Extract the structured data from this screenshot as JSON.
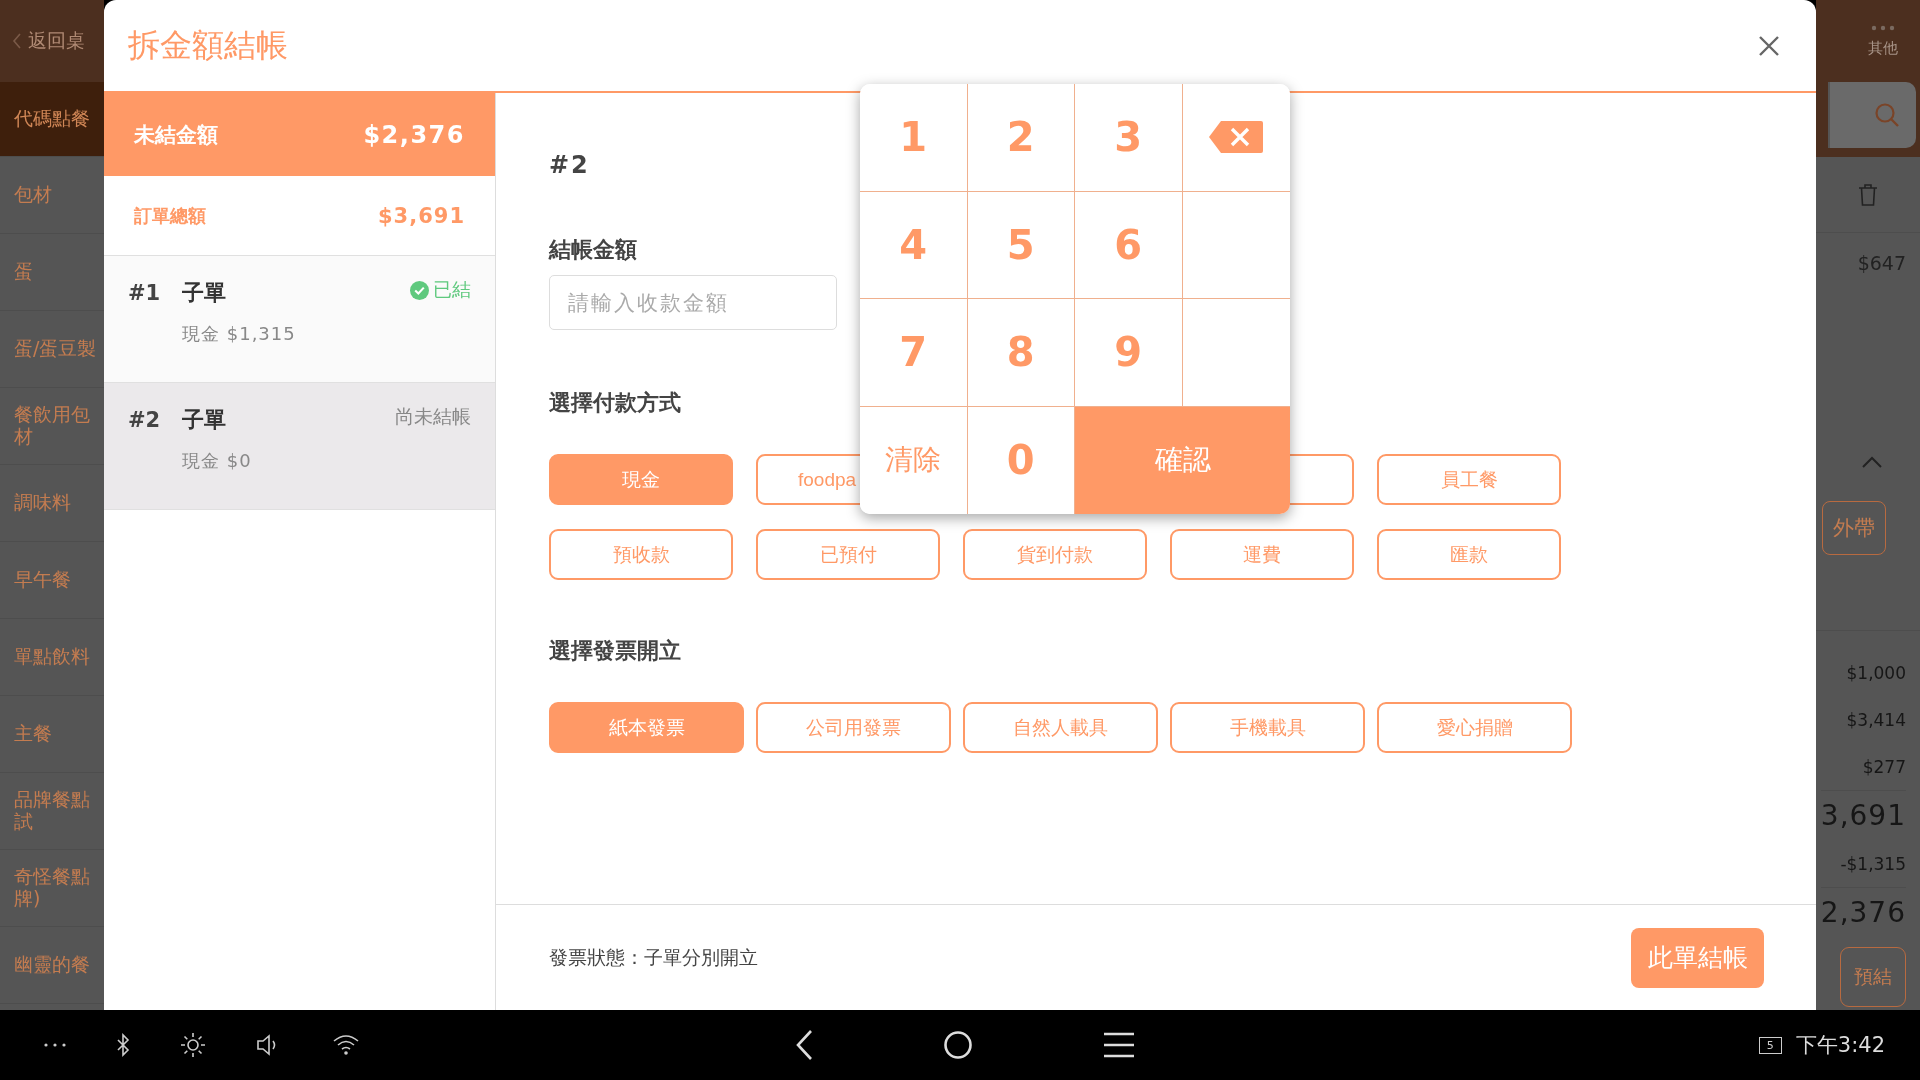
{
  "background_app": {
    "back_link": "返回桌",
    "categories": [
      {
        "label": "代碼點餐",
        "selected": true
      },
      {
        "label": "包材",
        "selected": false
      },
      {
        "label": "蛋",
        "selected": false
      },
      {
        "label": "蛋/蛋豆製",
        "selected": false
      },
      {
        "label": "餐飲用包材",
        "selected": false
      },
      {
        "label": "調味料",
        "selected": false
      },
      {
        "label": "早午餐",
        "selected": false
      },
      {
        "label": "單點飲料",
        "selected": false
      },
      {
        "label": "主餐",
        "selected": false
      },
      {
        "label": "品牌餐點試",
        "selected": false
      },
      {
        "label": "奇怪餐點牌)",
        "selected": false
      },
      {
        "label": "幽靈的餐",
        "selected": false
      }
    ],
    "more_label": "其他",
    "item_price": "$647",
    "takeout_button": "外帶",
    "summary_amounts": [
      "$1,000",
      "$3,414",
      "$277"
    ],
    "order_total": "3,691",
    "paid": "-$1,315",
    "remaining": "2,376",
    "prebill_button": "預結"
  },
  "dialog": {
    "title": "拆金額結帳",
    "unpaid": {
      "label": "未結金額",
      "amount": "$2,376"
    },
    "order_total": {
      "label": "訂單總額",
      "amount": "$3,691"
    },
    "sub_orders": [
      {
        "number": "#1",
        "name": "子單",
        "payment": "現金 $1,315",
        "status": "已結",
        "settled": true,
        "selected": false
      },
      {
        "number": "#2",
        "name": "子單",
        "payment": "現金 $0",
        "status": "尚未結帳",
        "settled": false,
        "selected": true
      }
    ],
    "current": "#2",
    "amount_label": "結帳金額",
    "amount_field": {
      "placeholder": "請輸入收款金額"
    },
    "payment_heading": "選擇付款方式",
    "payment_methods": [
      {
        "label": "現金",
        "selected": true,
        "covered": false
      },
      {
        "label": "foodpa",
        "selected": false,
        "covered": true
      },
      {
        "selected": false,
        "covered": true
      },
      {
        "label": "員工餐",
        "selected": false,
        "covered": false
      },
      {
        "label": "預收款",
        "selected": false,
        "covered": false
      },
      {
        "label": "已預付",
        "selected": false,
        "covered": false
      },
      {
        "label": "貨到付款",
        "selected": false,
        "covered": false
      },
      {
        "label": "運費",
        "selected": false,
        "covered": false
      },
      {
        "label": "匯款",
        "selected": false,
        "covered": false
      }
    ],
    "invoice_heading": "選擇發票開立",
    "invoice_types": [
      {
        "label": "紙本發票",
        "selected": true
      },
      {
        "label": "公司用發票",
        "selected": false
      },
      {
        "label": "自然人載具",
        "selected": false
      },
      {
        "label": "手機載具",
        "selected": false
      },
      {
        "label": "愛心捐贈",
        "selected": false
      }
    ],
    "invoice_status": "發票狀態：子單分別開立",
    "checkout_button": "此單結帳"
  },
  "keypad": {
    "keys": [
      {
        "kind": "digit",
        "label": "1"
      },
      {
        "kind": "digit",
        "label": "2"
      },
      {
        "kind": "digit",
        "label": "3"
      },
      {
        "kind": "backspace"
      },
      {
        "kind": "digit",
        "label": "4"
      },
      {
        "kind": "digit",
        "label": "5"
      },
      {
        "kind": "digit",
        "label": "6"
      },
      {
        "kind": "blank"
      },
      {
        "kind": "digit",
        "label": "7"
      },
      {
        "kind": "digit",
        "label": "8"
      },
      {
        "kind": "digit",
        "label": "9"
      },
      {
        "kind": "blank"
      },
      {
        "kind": "clear",
        "label": "清除"
      },
      {
        "kind": "digit",
        "label": "0"
      },
      {
        "kind": "confirm",
        "label": "確認"
      }
    ]
  },
  "status_bar": {
    "notification_count": "5",
    "time": "下午3:42"
  }
}
